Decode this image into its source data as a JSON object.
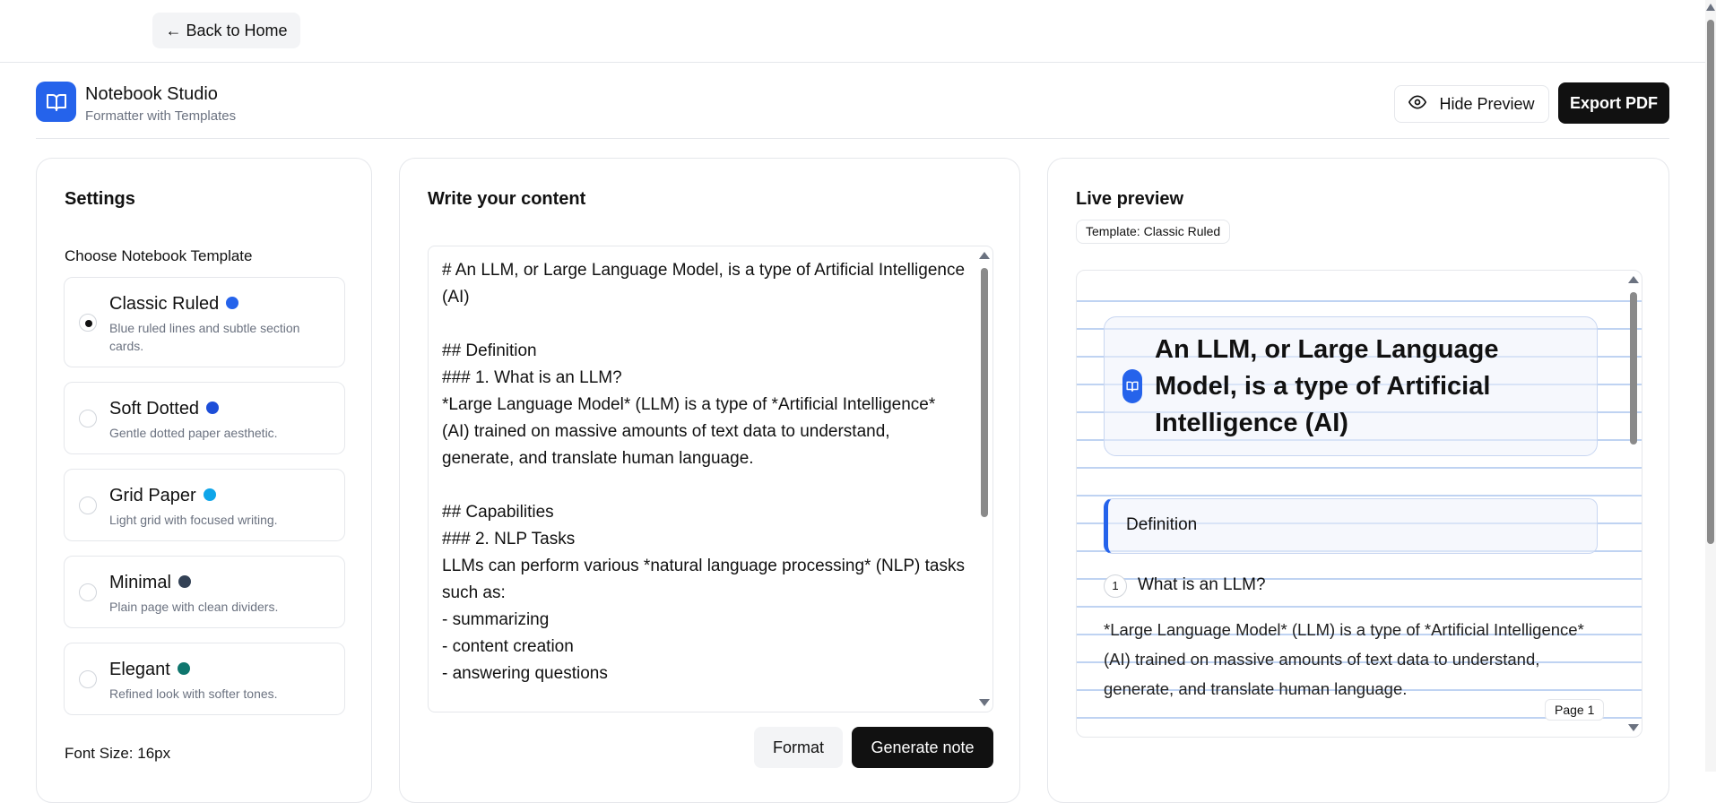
{
  "topbar": {
    "back_label": "← Back to Home"
  },
  "header": {
    "brand_title": "Notebook Studio",
    "brand_subtitle": "Formatter with Templates",
    "hide_preview_label": "Hide Preview",
    "export_label": "Export PDF",
    "logo_icon": "open-book-icon",
    "eye_icon": "eye-icon"
  },
  "settings": {
    "title": "Settings",
    "template_label": "Choose Notebook Template",
    "templates": [
      {
        "name": "Classic Ruled",
        "desc": "Blue ruled lines and subtle section cards.",
        "color": "#2563eb",
        "selected": true
      },
      {
        "name": "Soft Dotted",
        "desc": "Gentle dotted paper aesthetic.",
        "color": "#1d4ed8",
        "selected": false
      },
      {
        "name": "Grid Paper",
        "desc": "Light grid with focused writing.",
        "color": "#0ea5e9",
        "selected": false
      },
      {
        "name": "Minimal",
        "desc": "Plain page with clean dividers.",
        "color": "#334155",
        "selected": false
      },
      {
        "name": "Elegant",
        "desc": "Refined look with softer tones.",
        "color": "#0f766e",
        "selected": false
      }
    ],
    "font_size_label": "Font Size: 16px"
  },
  "editor": {
    "title": "Write your content",
    "content": "# An LLM, or Large Language Model, is a type of Artificial Intelligence (AI)\n\n## Definition\n### 1. What is an LLM?\n*Large Language Model* (LLM) is a type of *Artificial Intelligence* (AI) trained on massive amounts of text data to understand, generate, and translate human language.\n\n## Capabilities\n### 2. NLP Tasks\nLLMs can perform various *natural language processing* (NLP) tasks such as:\n- summarizing\n- content creation\n- answering questions",
    "format_label": "Format",
    "generate_label": "Generate note"
  },
  "preview": {
    "title": "Live preview",
    "template_badge": "Template: Classic Ruled",
    "doc_title": "An LLM, or Large Language Model, is a type of Artificial Intelligence (AI)",
    "section": "Definition",
    "sub_number": "1",
    "sub_title": "What is an LLM?",
    "body": "*Large Language Model* (LLM) is a type of *Artificial Intelligence* (AI) trained on massive amounts of text data to understand, generate, and translate human language.",
    "page_label": "Page 1",
    "rule_color": "#bfd3f2",
    "accent_color": "#2563eb"
  }
}
